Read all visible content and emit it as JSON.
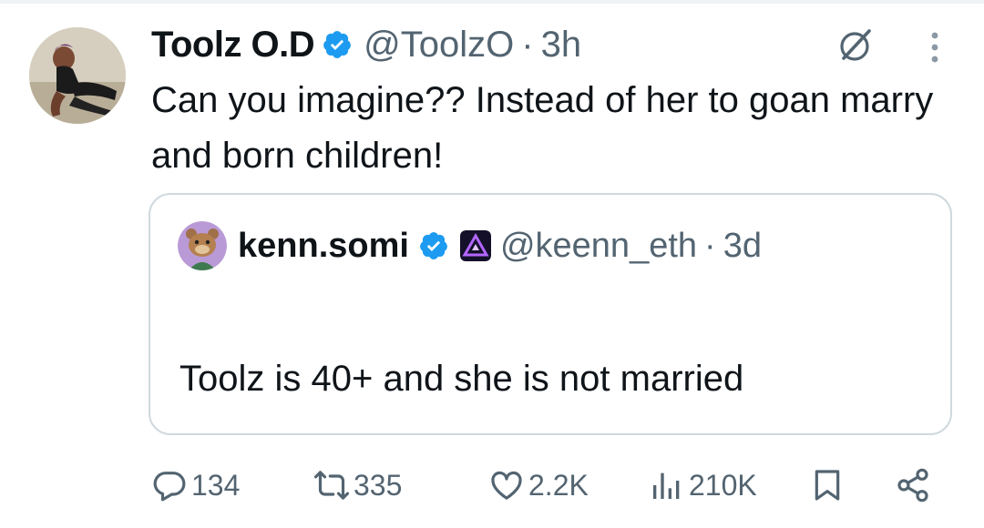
{
  "tweet": {
    "display_name": "Toolz O.D",
    "handle": "@ToolzO",
    "separator": "·",
    "time": "3h",
    "text": "Can you imagine?? Instead of her to goan marry and born children!"
  },
  "quoted_tweet": {
    "display_name": "kenn.somi",
    "handle": "@keenn_eth",
    "separator": "·",
    "time": "3d",
    "text": "Toolz is 40+ and she is not married"
  },
  "actions": {
    "replies": "134",
    "reposts": "335",
    "likes": "2.2K",
    "views": "210K"
  },
  "icons": {
    "verified": "verified-badge-icon",
    "grok": "grok-icon",
    "more": "more-vertical-icon",
    "affiliate": "affiliate-badge-icon",
    "reply": "reply-icon",
    "repost": "repost-icon",
    "like": "heart-icon",
    "views": "views-icon",
    "bookmark": "bookmark-icon",
    "share": "share-icon"
  },
  "colors": {
    "verified_blue": "#1d9bf0",
    "text_primary": "#0f1419",
    "text_secondary": "#536471",
    "border": "#cfd9de"
  }
}
